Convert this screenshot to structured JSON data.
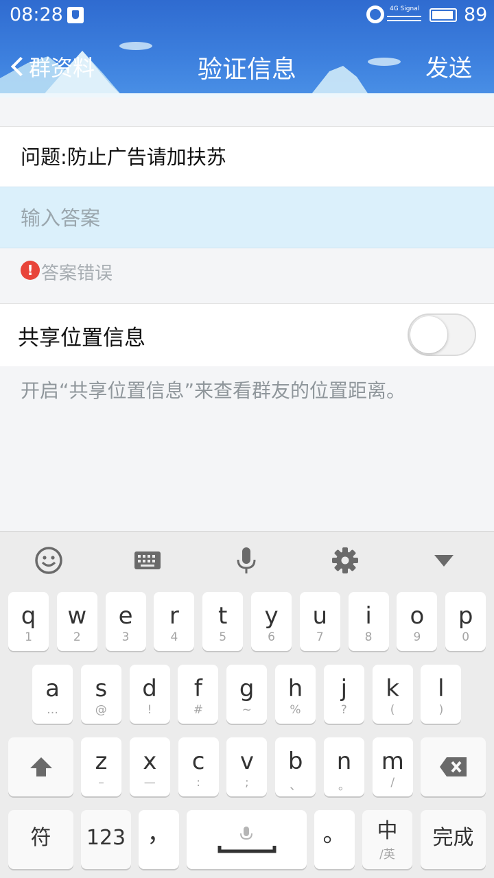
{
  "status_bar": {
    "time": "08:28",
    "network": "4G Signal",
    "battery": "89"
  },
  "nav": {
    "back_label": "群资料",
    "title": "验证信息",
    "send_label": "发送"
  },
  "question": {
    "text": "问题:防止广告请加扶苏"
  },
  "answer": {
    "placeholder": "输入答案",
    "value": ""
  },
  "error": {
    "text": "答案错误"
  },
  "share_location": {
    "label": "共享位置信息",
    "enabled": false
  },
  "hint": {
    "text": "开启“共享位置信息”来查看群友的位置距离。"
  },
  "keyboard": {
    "toolbar": [
      "emoji-icon",
      "keyboard-icon",
      "mic-icon",
      "gear-icon",
      "collapse-icon"
    ],
    "row1": [
      {
        "key": "q",
        "sub": "1"
      },
      {
        "key": "w",
        "sub": "2"
      },
      {
        "key": "e",
        "sub": "3"
      },
      {
        "key": "r",
        "sub": "4"
      },
      {
        "key": "t",
        "sub": "5"
      },
      {
        "key": "y",
        "sub": "6"
      },
      {
        "key": "u",
        "sub": "7"
      },
      {
        "key": "i",
        "sub": "8"
      },
      {
        "key": "o",
        "sub": "9"
      },
      {
        "key": "p",
        "sub": "0"
      }
    ],
    "row2": [
      {
        "key": "a",
        "sub": "…"
      },
      {
        "key": "s",
        "sub": "@"
      },
      {
        "key": "d",
        "sub": "!"
      },
      {
        "key": "f",
        "sub": "#"
      },
      {
        "key": "g",
        "sub": "~"
      },
      {
        "key": "h",
        "sub": "%"
      },
      {
        "key": "j",
        "sub": "?"
      },
      {
        "key": "k",
        "sub": "("
      },
      {
        "key": "l",
        "sub": ")"
      }
    ],
    "row3": [
      {
        "key": "z",
        "sub": "–"
      },
      {
        "key": "x",
        "sub": "—"
      },
      {
        "key": "c",
        "sub": ":"
      },
      {
        "key": "v",
        "sub": ";"
      },
      {
        "key": "b",
        "sub": "、"
      },
      {
        "key": "n",
        "sub": "。"
      },
      {
        "key": "m",
        "sub": "/"
      }
    ],
    "symbols_label": "符",
    "numbers_label": "123",
    "comma_label": "，",
    "period_label": "。",
    "lang_label": "中",
    "lang_sub": "/英",
    "done_label": "完成"
  }
}
